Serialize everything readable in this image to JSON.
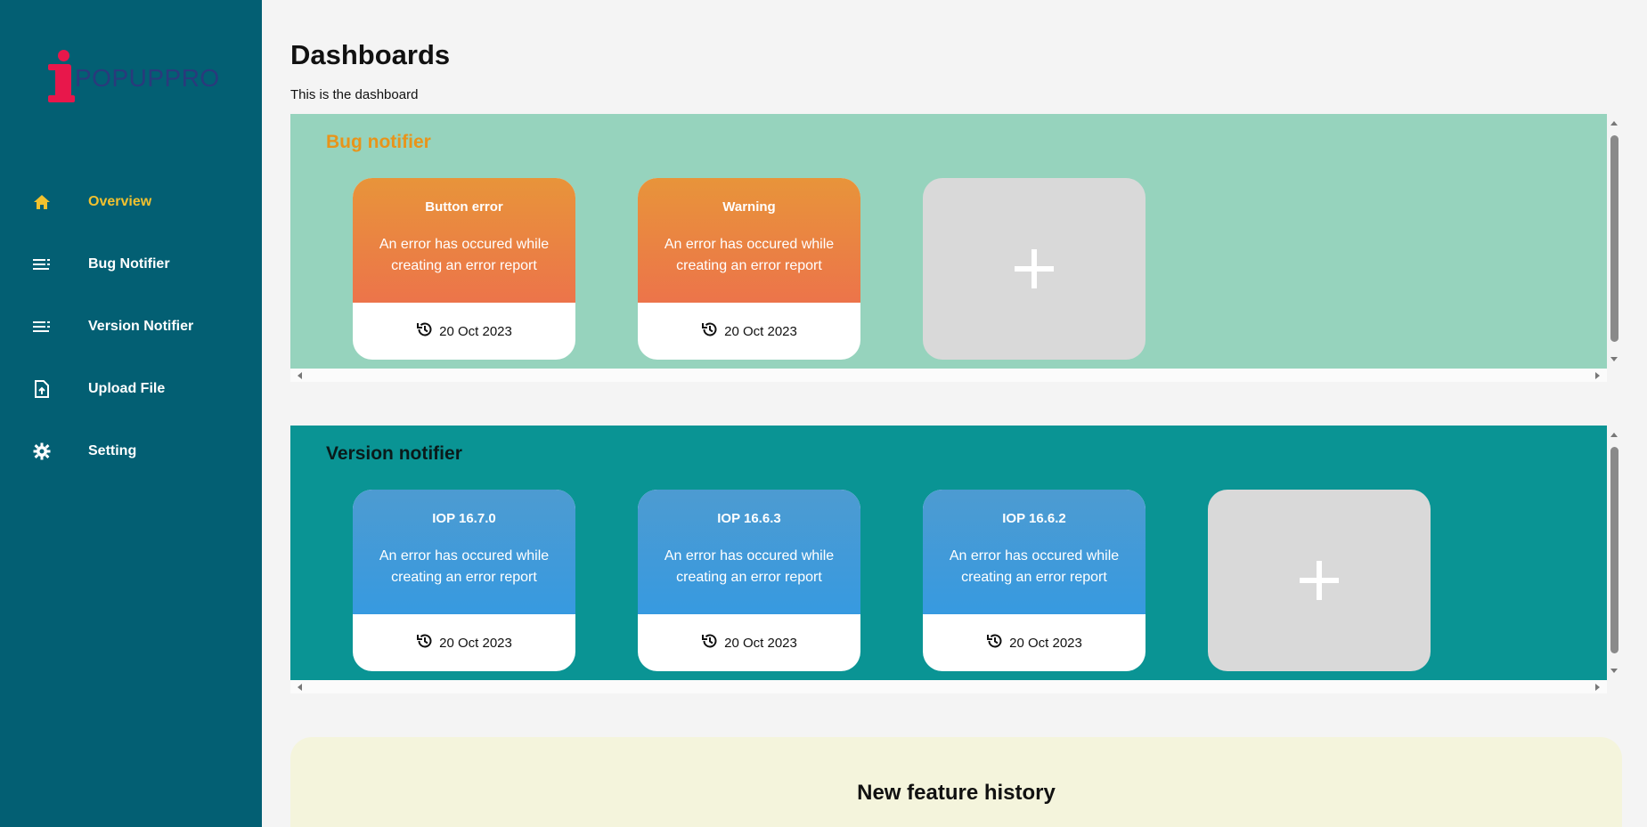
{
  "brand": {
    "logo_text": "POPUPPRO",
    "accent": "#e8174b",
    "logo_color": "#2a3a7c"
  },
  "sidebar": {
    "bg": "#035f73",
    "items": [
      {
        "label": "Overview",
        "icon": "home-icon",
        "active": true
      },
      {
        "label": "Bug Notifier",
        "icon": "list-icon",
        "active": false
      },
      {
        "label": "Version Notifier",
        "icon": "list-icon",
        "active": false
      },
      {
        "label": "Upload File",
        "icon": "file-upload-icon",
        "active": false
      },
      {
        "label": "Setting",
        "icon": "gear-icon",
        "active": false
      }
    ]
  },
  "main": {
    "title": "Dashboards",
    "subtitle": "This is the dashboard",
    "bug_section": {
      "title": "Bug notifier",
      "title_color": "#e8941a",
      "bg": "#96d3bd",
      "cards": [
        {
          "title": "Button error",
          "desc": "An error has occured while creating an error report",
          "date": "20 Oct 2023"
        },
        {
          "title": "Warning",
          "desc": "An error has occured while creating an error report",
          "date": "20 Oct 2023"
        }
      ]
    },
    "version_section": {
      "title": "Version notifier",
      "title_color": "#0a1a1a",
      "bg": "#0a9494",
      "cards": [
        {
          "title": "IOP 16.7.0",
          "desc": "An error has occured while creating an error report",
          "date": "20 Oct 2023"
        },
        {
          "title": "IOP 16.6.3",
          "desc": "An error has occured while creating an error report",
          "date": "20 Oct 2023"
        },
        {
          "title": "IOP 16.6.2",
          "desc": "An error has occured while creating an error report",
          "date": "20 Oct 2023"
        }
      ]
    },
    "feature_section": {
      "title": "New feature history"
    }
  }
}
